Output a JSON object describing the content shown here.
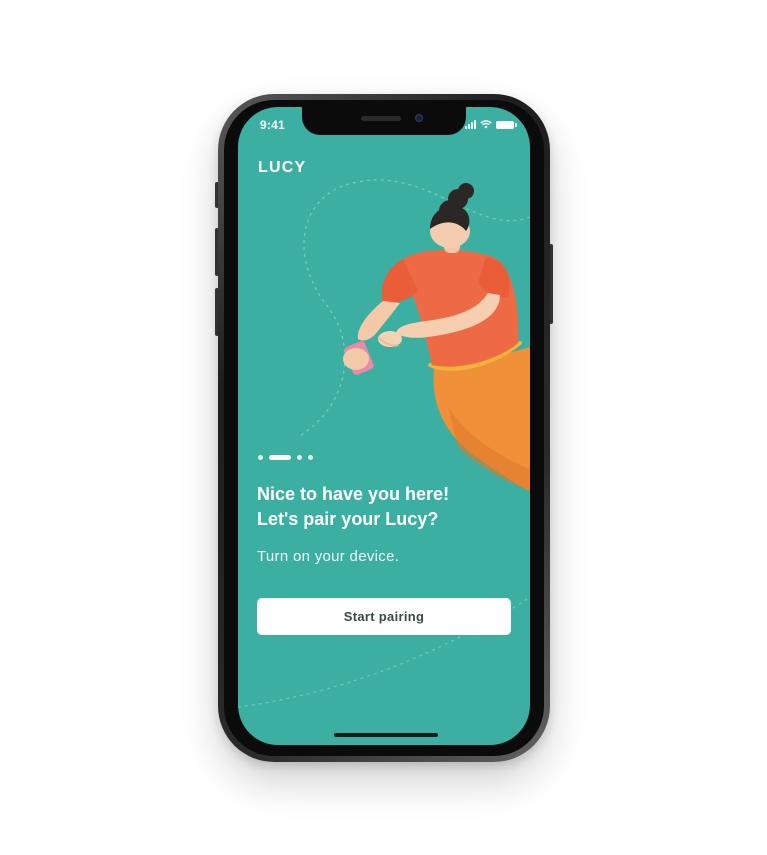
{
  "status_bar": {
    "time": "9:41"
  },
  "app": {
    "logo": "LUCY"
  },
  "onboarding": {
    "step_count": 4,
    "active_step": 2,
    "headline_line1": "Nice to have you here!",
    "headline_line2": "Let's pair your Lucy?",
    "subtitle": "Turn on your device.",
    "cta_label": "Start pairing"
  },
  "colors": {
    "background": "#3aafa2",
    "button": "#ffffff",
    "button_text": "#3b4a48",
    "shirt": "#ee6a44",
    "pants": "#f0913a"
  },
  "icons": [
    "signal-icon",
    "wifi-icon",
    "battery-icon",
    "woman-with-phone-illustration"
  ]
}
